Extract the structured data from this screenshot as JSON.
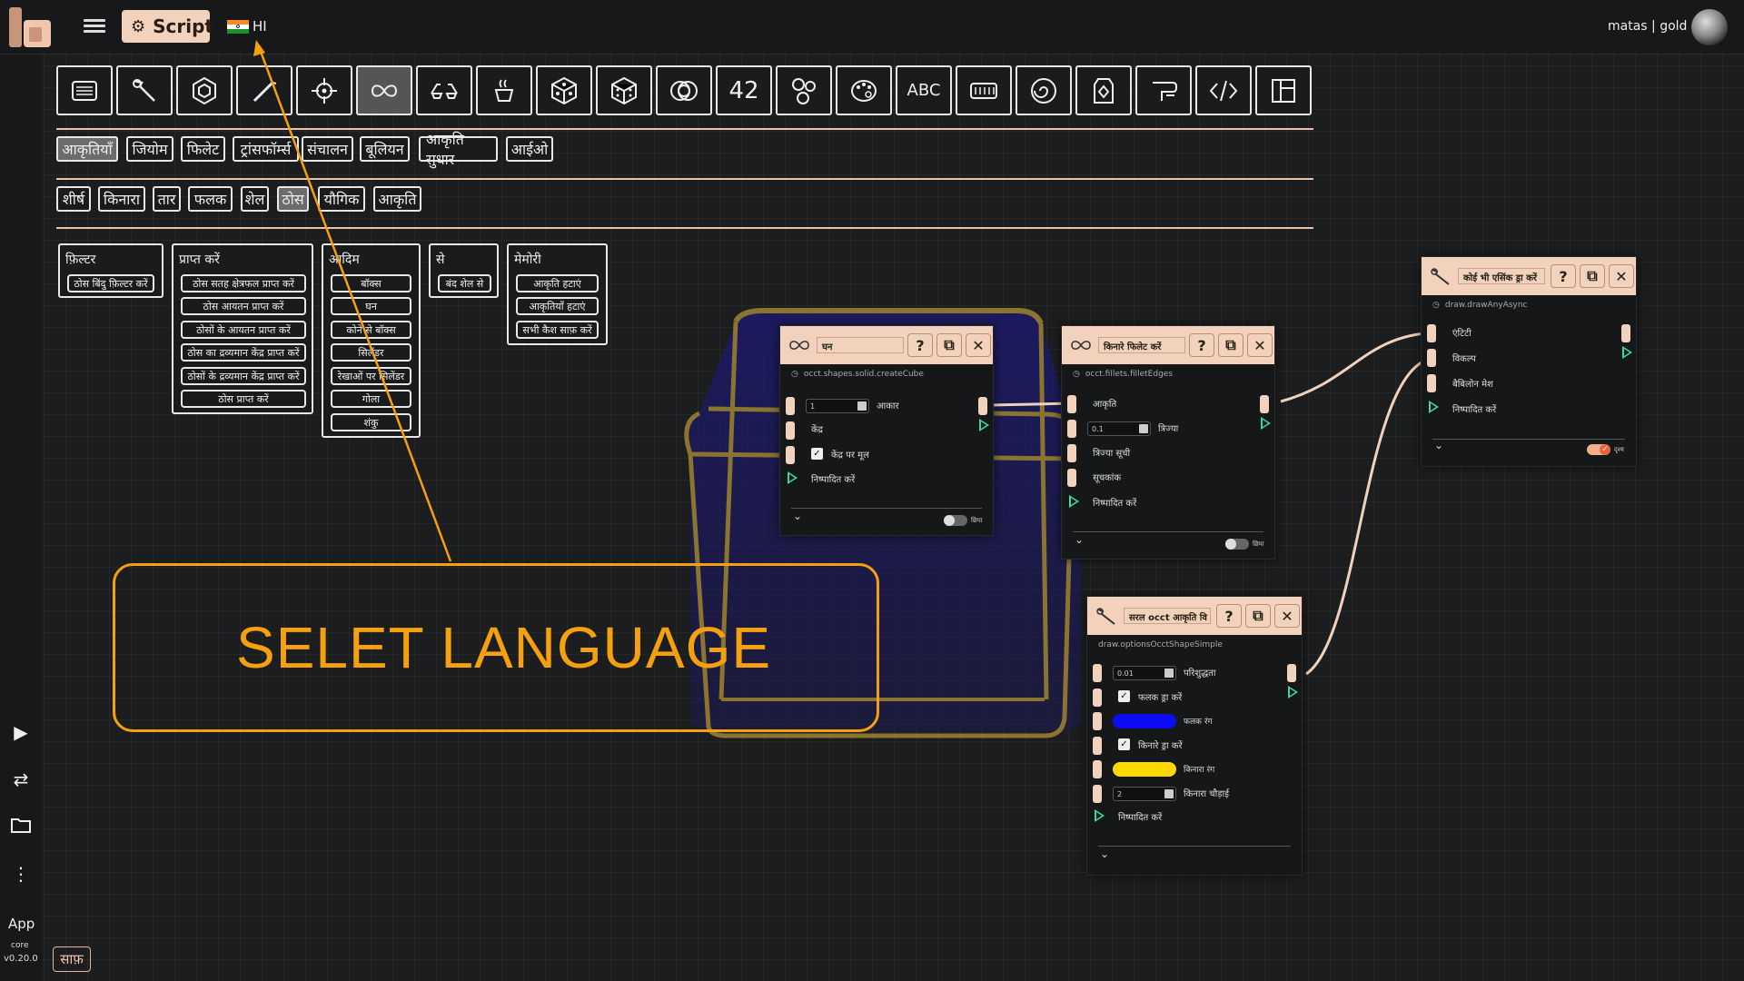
{
  "topbar": {
    "script_label": "Script",
    "language_code": "HI",
    "user": "matas | gold"
  },
  "sidebar": {
    "app_label": "App",
    "core_label": "core",
    "version": "v0.20.0",
    "clear_label": "साफ़"
  },
  "toolbar": {
    "icons": [
      "code-editor-icon",
      "wrench-icon",
      "hexagon-icon",
      "magic-wand-icon",
      "target-icon",
      "infinity-icon",
      "glasses-icon",
      "coffee-cup-icon",
      "cube-icon",
      "dice-icon",
      "rings-icon",
      "number-42-icon",
      "molecule-icon",
      "palette-icon",
      "abc-icon",
      "keyboard-icon",
      "spiral-icon",
      "tag-icon",
      "pipe-icon",
      "code-tag-icon",
      "sidebar-layout-icon"
    ],
    "number_label": "42",
    "abc_label": "ABC",
    "active_index": 5
  },
  "category_tabs": [
    "आकृतियाँ",
    "जियोम",
    "फिलेट",
    "ट्रांसफॉर्म्स",
    "संचालन",
    "बूलियन",
    "आकृति सुधार",
    "आईओ"
  ],
  "subcategory_tabs": [
    "शीर्ष",
    "किनारा",
    "तार",
    "फलक",
    "शेल",
    "ठोस",
    "यौगिक",
    "आकृति"
  ],
  "menu_groups": {
    "filter": {
      "title": "फ़िल्टर",
      "items": [
        "ठोस बिंदु फ़िल्टर करें"
      ]
    },
    "get": {
      "title": "प्राप्त करें",
      "items": [
        "ठोस सतह क्षेत्रफल प्राप्त करें",
        "ठोस आयतन प्राप्त करें",
        "ठोसों के आयतन प्राप्त करें",
        "ठोस का द्रव्यमान केंद्र प्राप्त करें",
        "ठोसों के द्रव्यमान केंद्र प्राप्त करें",
        "ठोस प्राप्त करें"
      ]
    },
    "primitive": {
      "title": "आदिम",
      "items": [
        "बॉक्स",
        "घन",
        "कोने से बॉक्स",
        "सिलेंडर",
        "रेखाओं पर सिलेंडर",
        "गोला",
        "शंकु"
      ]
    },
    "from": {
      "title": "से",
      "items": [
        "बंद शेल से"
      ]
    },
    "memory": {
      "title": "मेमोरी",
      "items": [
        "आकृति हटाएं",
        "आकृतियाँ हटाएं",
        "सभी कैश साफ़ करें"
      ]
    }
  },
  "nodes": {
    "cube": {
      "title": "घन",
      "subtitle": "occt.shapes.solid.createCube",
      "size_value": "1",
      "size_label": "आकार",
      "center_label": "केंद्र",
      "origin_label": "केंद्र पर मूल",
      "origin_checked": true,
      "execute_label": "निष्पादित करें",
      "toggle_label": "छिपा"
    },
    "fillet": {
      "title": "किनारे फिलेट करें",
      "subtitle": "occt.fillets.filletEdges",
      "shape_label": "आकृति",
      "radius_value": "0.1",
      "radius_label": "त्रिज्या",
      "radius_list_label": "त्रिज्या सूची",
      "indexes_label": "सूचकांक",
      "execute_label": "निष्पादित करें",
      "toggle_label": "छिपा"
    },
    "draw_options": {
      "title": "सरल occt आकृति वि",
      "subtitle": "draw.optionsOcctShapeSimple",
      "precision_value": "0.01",
      "precision_label": "परिशुद्धता",
      "draw_faces_label": "फलक ड्रा करें",
      "face_color_label": "फलक रंग",
      "face_color": "#0b0bf5",
      "draw_edges_label": "किनारे ड्रा करें",
      "edge_color_label": "किनारा रंग",
      "edge_color": "#ffd800",
      "edge_width_value": "2",
      "edge_width_label": "किनारा चौड़ाई",
      "execute_label": "निष्पादित करें"
    },
    "draw_any": {
      "title": "कोई भी एसिंक ड्रा करें",
      "subtitle": "draw.drawAnyAsync",
      "entity_label": "एंटिटी",
      "options_label": "विकल्प",
      "babylon_mesh_label": "बैबिलोन मेश",
      "execute_label": "निष्पादित करें",
      "toggle_label": "दृश्य",
      "toggle_on": true
    }
  },
  "callout": {
    "text": "SELET LANGUAGE"
  },
  "colors": {
    "accent": "#f3d2bd",
    "exec": "#3cd6a6",
    "callout": "#f5a00e",
    "wire": "#f3d2bd"
  }
}
